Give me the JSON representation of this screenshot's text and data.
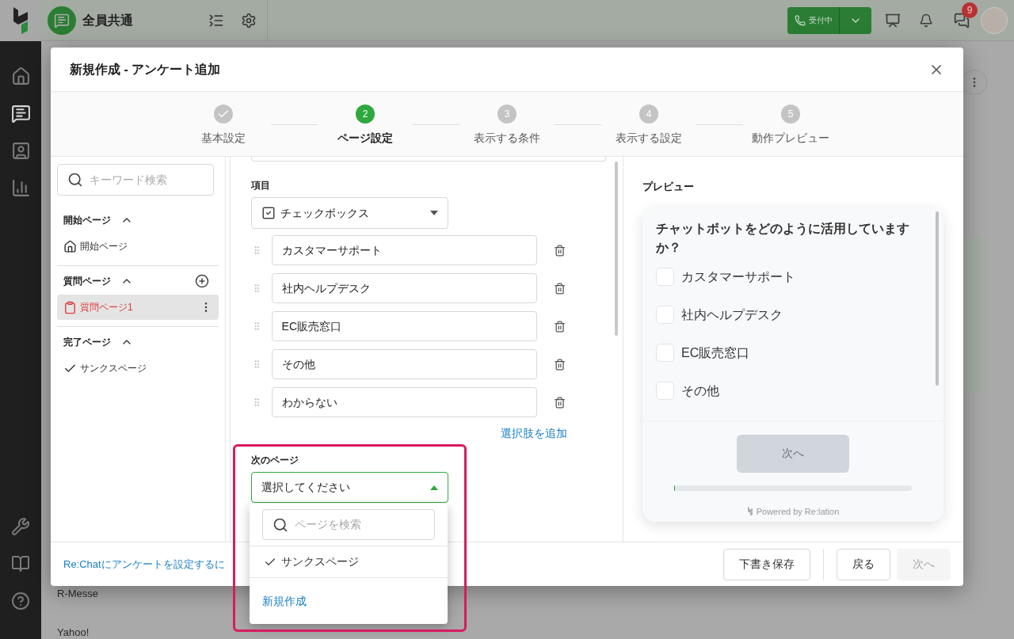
{
  "app": {
    "workspace": "全員共通",
    "status_button": "受付中",
    "notification_badge": "9",
    "nav_items": [
      {
        "selected": false
      },
      {
        "selected": true
      },
      {
        "selected": false
      },
      {
        "selected": false
      }
    ],
    "background_rows": [
      "R-Messe",
      "Yahoo!"
    ]
  },
  "modal": {
    "title": "新規作成 - アンケート追加",
    "steps": [
      {
        "label": "基本設定",
        "completed": true,
        "selected": false
      },
      {
        "label": "ページ設定",
        "number": "2",
        "completed": false,
        "selected": true
      },
      {
        "label": "表示する条件",
        "number": "3",
        "completed": false,
        "selected": false
      },
      {
        "label": "表示する設定",
        "number": "4",
        "completed": false,
        "selected": false
      },
      {
        "label": "動作プレビュー",
        "number": "5",
        "completed": false,
        "selected": false
      }
    ],
    "sidebar": {
      "search_placeholder": "キーワード検索",
      "sections": [
        {
          "title": "開始ページ",
          "expanded": true,
          "addable": false,
          "items": [
            {
              "label": "開始ページ",
              "kind": "home",
              "selected": false
            }
          ]
        },
        {
          "title": "質問ページ",
          "expanded": true,
          "addable": true,
          "items": [
            {
              "label": "質問ページ1",
              "kind": "question",
              "selected": true
            }
          ]
        },
        {
          "title": "完了ページ",
          "expanded": true,
          "addable": false,
          "items": [
            {
              "label": "サンクスページ",
              "kind": "thanks",
              "selected": false
            }
          ]
        }
      ]
    },
    "editor": {
      "item_label": "項目",
      "item_type": "チェックボックス",
      "choices": [
        "カスタマーサポート",
        "社内ヘルプデスク",
        "EC販売窓口",
        "その他",
        "わからない"
      ],
      "add_choice": "選択肢を追加",
      "next_page_label": "次のページ",
      "next_page_placeholder": "選択してください",
      "dropdown": {
        "open": true,
        "search_placeholder": "ページを検索",
        "options": [
          {
            "label": "サンクスページ",
            "selected": true
          }
        ],
        "create": "新規作成"
      }
    },
    "preview": {
      "title": "プレビュー",
      "question": "チャットボットをどのように活用していますか？",
      "options": [
        {
          "label": "カスタマーサポート",
          "checked": false
        },
        {
          "label": "社内ヘルプデスク",
          "checked": false
        },
        {
          "label": "EC販売窓口",
          "checked": false
        },
        {
          "label": "その他",
          "checked": false
        }
      ],
      "next_button": "次へ",
      "progress": {
        "level": 0
      },
      "powered_by": "Powered by Re:lation"
    },
    "footer": {
      "help_link": "Re:Chatにアンケートを設定するに",
      "button_groups": [
        [
          {
            "label": "下書き保存",
            "disabled": false
          }
        ],
        [
          {
            "label": "戻る",
            "disabled": false
          },
          {
            "label": "次へ",
            "disabled": true
          }
        ]
      ]
    }
  }
}
